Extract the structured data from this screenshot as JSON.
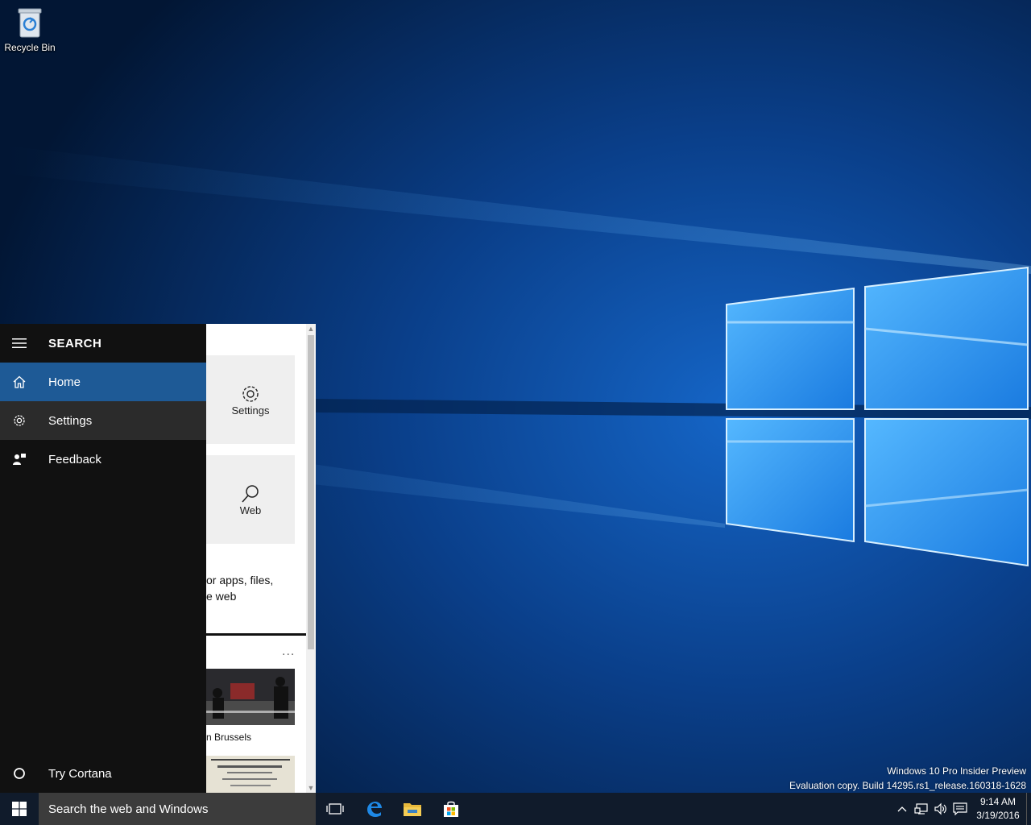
{
  "desktop": {
    "icons": [
      {
        "label": "Recycle Bin",
        "icon": "recycle-bin-icon"
      }
    ],
    "watermark": {
      "line1": "Windows 10 Pro Insider Preview",
      "line2": "Evaluation copy. Build 14295.rs1_release.160318-1628"
    }
  },
  "search_panel": {
    "title": "SEARCH",
    "nav": [
      {
        "label": "Home",
        "icon": "home-icon",
        "state": "selected"
      },
      {
        "label": "Settings",
        "icon": "gear-icon",
        "state": "hover"
      },
      {
        "label": "Feedback",
        "icon": "feedback-icon",
        "state": "normal"
      }
    ],
    "bottom": {
      "label": "Try Cortana",
      "icon": "circle-icon"
    },
    "content": {
      "tiles": [
        {
          "label": "Settings",
          "icon": "gear-icon"
        },
        {
          "label": "Web",
          "icon": "search-icon"
        }
      ],
      "description": [
        "or apps, files,",
        "e web"
      ],
      "more": "...",
      "news": [
        {
          "caption": "n Brussels"
        },
        {
          "caption": ""
        }
      ]
    }
  },
  "taskbar": {
    "search_placeholder": "Search the web and Windows",
    "pinned": [
      "task-view-icon",
      "edge-icon",
      "file-explorer-icon",
      "store-icon"
    ],
    "clock": {
      "time": "9:14 AM",
      "date": "3/19/2016"
    },
    "tray_icons": [
      "chevron-up-icon",
      "network-icon",
      "volume-icon",
      "action-center-icon"
    ]
  },
  "colors": {
    "accent": "#1e5a96",
    "nav_bg": "#111111",
    "taskbar_bg": "#101b2b"
  }
}
